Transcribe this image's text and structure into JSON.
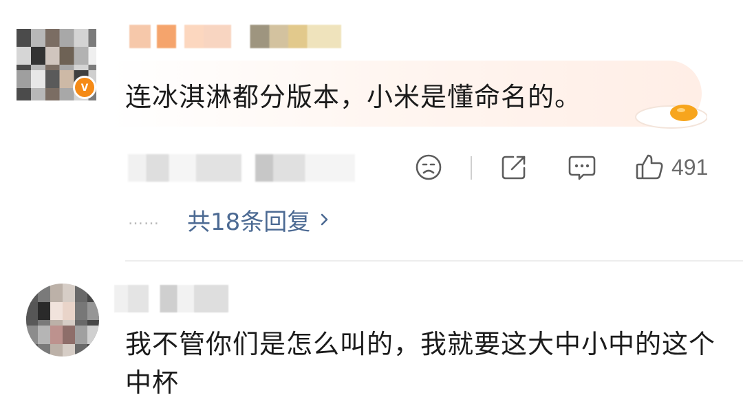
{
  "comments": [
    {
      "avatar_badge": "v",
      "text": "连冰淇淋都分版本，小米是懂命名的。",
      "bubble_decoration": "fried-egg-icon",
      "actions": {
        "dislike_icon": "sad-face-icon",
        "share_icon": "share-icon",
        "comment_icon": "comment-bubble-icon",
        "like_icon": "thumbs-up-icon",
        "like_count": "491"
      },
      "replies": {
        "dots": "……",
        "label": "共18条回复",
        "chevron_icon": "chevron-right-icon"
      }
    },
    {
      "text": "我不管你们是怎么叫的，我就要这大中小中的这个中杯"
    }
  ],
  "colors": {
    "badge": "#f58a16",
    "reply_link": "#4c6a93",
    "icon_gray": "#5c5c5c",
    "bubble_tint": "#ffeee6"
  }
}
